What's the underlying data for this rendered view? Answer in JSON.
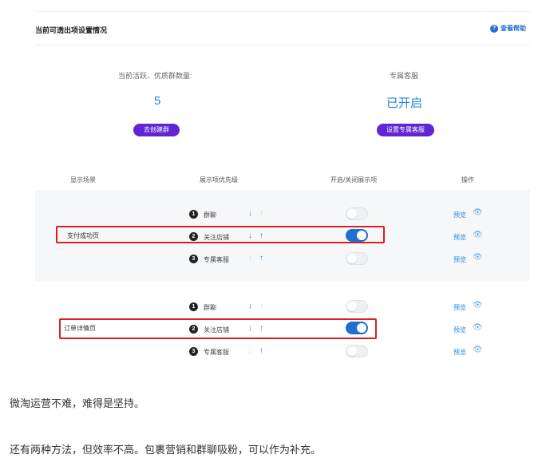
{
  "panel": {
    "title": "当前可透出项设置情况",
    "help_label": "查看帮助",
    "help_icon": "?"
  },
  "stats": [
    {
      "label": "当前活跃、优质群数量:",
      "value": "5",
      "button": "去创建群"
    },
    {
      "label": "专属客服",
      "value": "已开启",
      "button": "设置专属客服"
    }
  ],
  "table": {
    "headers": [
      "显示场景",
      "展示项优先级",
      "开启/关闭展示项",
      "操作"
    ],
    "groups": [
      {
        "scene": "支付成功页",
        "rows": [
          {
            "rank": "1",
            "name": "群聊",
            "up_enabled": false,
            "down_enabled": true,
            "enabled": false,
            "action": "预览"
          },
          {
            "rank": "2",
            "name": "关注店铺",
            "up_enabled": true,
            "down_enabled": true,
            "enabled": true,
            "action": "预览"
          },
          {
            "rank": "3",
            "name": "专属客服",
            "up_enabled": true,
            "down_enabled": false,
            "enabled": false,
            "action": "预览"
          }
        ]
      },
      {
        "scene": "订单详情页",
        "rows": [
          {
            "rank": "1",
            "name": "群聊",
            "up_enabled": false,
            "down_enabled": true,
            "enabled": false,
            "action": "预览"
          },
          {
            "rank": "2",
            "name": "关注店铺",
            "up_enabled": true,
            "down_enabled": true,
            "enabled": true,
            "action": "预览"
          },
          {
            "rank": "3",
            "name": "专属客服",
            "up_enabled": true,
            "down_enabled": false,
            "enabled": false,
            "action": "预览"
          }
        ]
      }
    ]
  },
  "article": {
    "para1": "微淘运营不难，难得是坚持。",
    "para2": "还有两种方法，但效率不高。包裹营销和群聊吸粉，可以作为补充。"
  },
  "icons": {
    "arrow_down": "↓",
    "arrow_up": "↑",
    "eye": "👁"
  },
  "colors": {
    "accent_blue": "#1d86d6",
    "button_purple": "#6125d4",
    "highlight_red": "#d62020"
  }
}
